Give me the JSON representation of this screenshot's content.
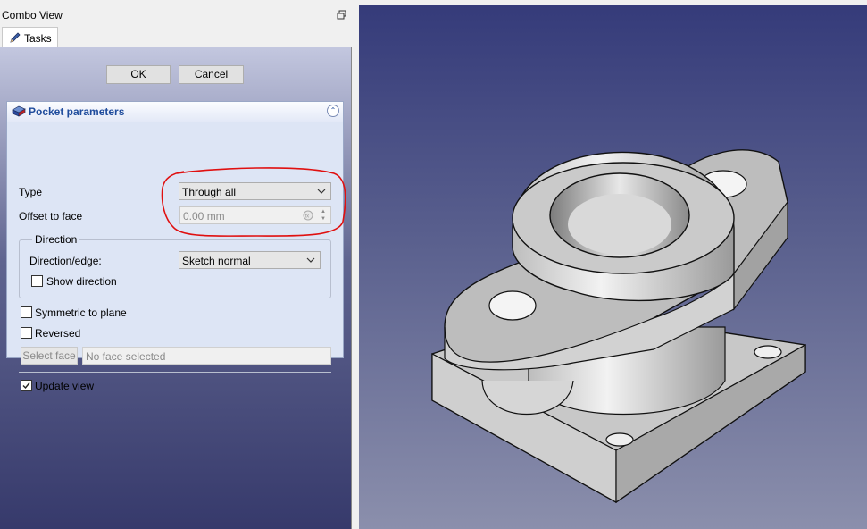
{
  "combo_view": {
    "title": "Combo View",
    "tab_label": "Tasks"
  },
  "dialog": {
    "ok_label": "OK",
    "cancel_label": "Cancel"
  },
  "pocket": {
    "title": "Pocket parameters",
    "type_label": "Type",
    "type_value": "Through all",
    "offset_label": "Offset to face",
    "offset_value": "0.00 mm",
    "direction_group": "Direction",
    "direction_edge_label": "Direction/edge:",
    "direction_edge_value": "Sketch normal",
    "show_direction_label": "Show direction",
    "show_direction_checked": false,
    "symmetric_label": "Symmetric to plane",
    "symmetric_checked": false,
    "reversed_label": "Reversed",
    "reversed_checked": false,
    "select_face_label": "Select face",
    "face_placeholder": "No face selected",
    "update_view_label": "Update view",
    "update_view_checked": true
  },
  "icons": {
    "restore": "restore-window-icon",
    "tasks": "pencil-icon",
    "pocket": "pocket-feature-icon",
    "collapse": "chevron-up-double-icon"
  },
  "colors": {
    "panel_title": "#1f4c9c",
    "highlight_circle": "#e01010"
  }
}
